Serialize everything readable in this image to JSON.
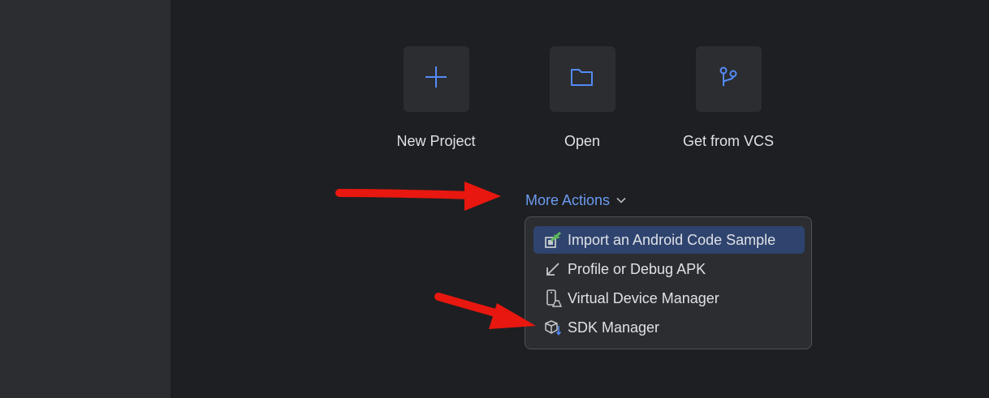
{
  "actions": [
    {
      "label": "New Project",
      "icon": "plus-icon"
    },
    {
      "label": "Open",
      "icon": "folder-icon"
    },
    {
      "label": "Get from VCS",
      "icon": "vcs-branch-icon"
    }
  ],
  "more_actions": {
    "label": "More Actions",
    "icon": "chevron-down-icon"
  },
  "menu": {
    "items": [
      {
        "label": "Import an Android Code Sample",
        "icon": "import-sample-icon",
        "selected": true
      },
      {
        "label": "Profile or Debug APK",
        "icon": "arrow-down-left-icon",
        "selected": false
      },
      {
        "label": "Virtual Device Manager",
        "icon": "device-icon",
        "selected": false
      },
      {
        "label": "SDK Manager",
        "icon": "sdk-box-icon",
        "selected": false
      }
    ]
  },
  "colors": {
    "background": "#1e1f22",
    "sidebar": "#2b2d30",
    "accent": "#6b9bf0",
    "selected": "#2e436e",
    "annotation_arrow": "#e8170f"
  }
}
